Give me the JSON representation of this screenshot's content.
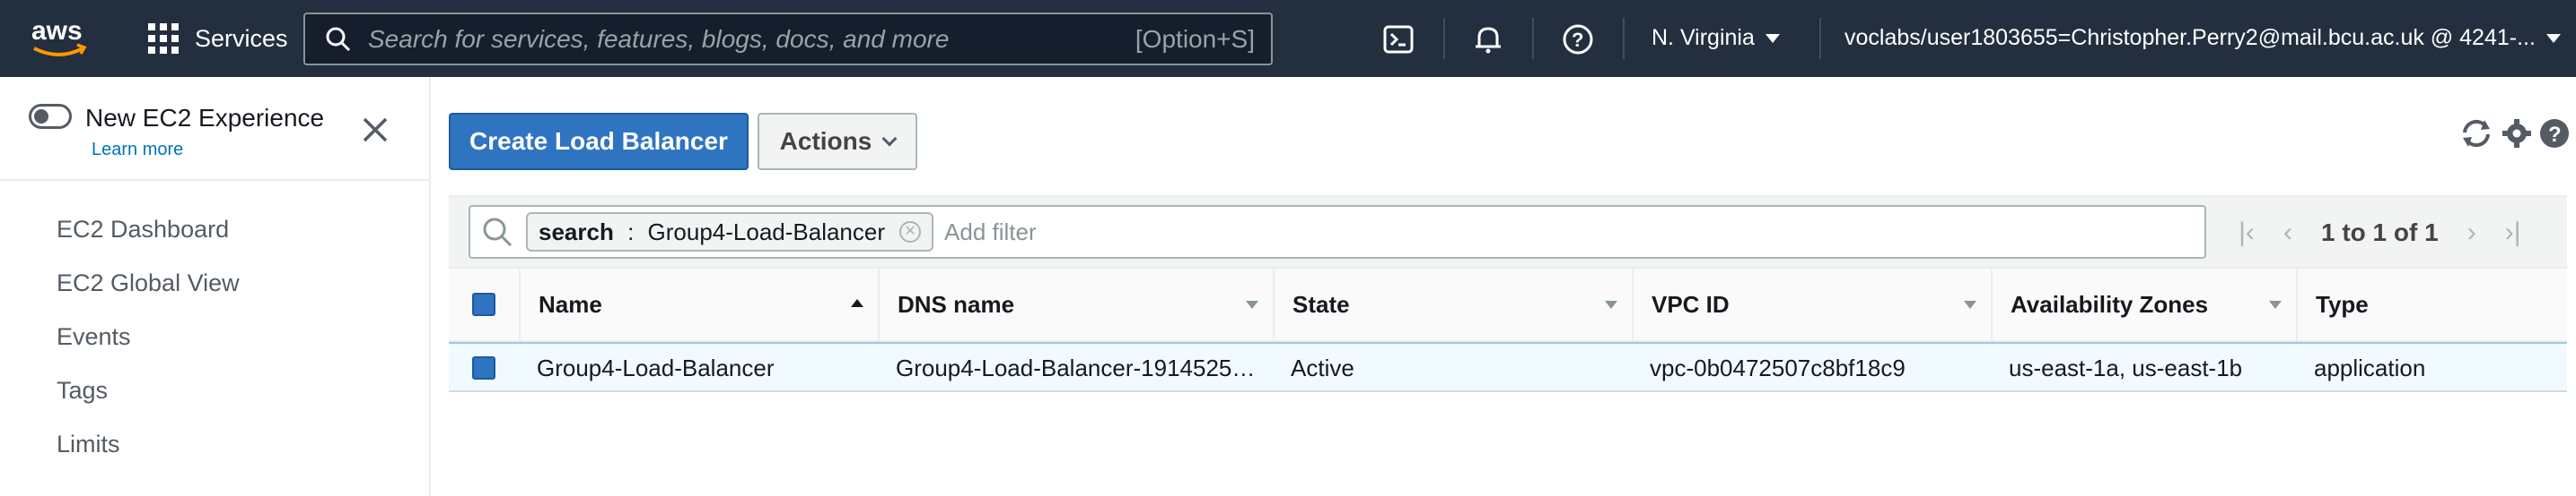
{
  "topnav": {
    "logo_text": "aws",
    "services_label": "Services",
    "search_placeholder": "Search for services, features, blogs, docs, and more",
    "search_shortcut": "[Option+S]",
    "region": "N. Virginia",
    "account": "voclabs/user1803655=Christopher.Perry2@mail.bcu.ac.uk @ 4241-..."
  },
  "sidebar": {
    "toggle_label": "New EC2 Experience",
    "learn_more": "Learn more",
    "items": [
      {
        "label": "EC2 Dashboard"
      },
      {
        "label": "EC2 Global View"
      },
      {
        "label": "Events"
      },
      {
        "label": "Tags"
      },
      {
        "label": "Limits"
      }
    ]
  },
  "toolbar": {
    "create_label": "Create Load Balancer",
    "actions_label": "Actions"
  },
  "filter": {
    "token_key": "search",
    "token_sep": " : ",
    "token_value": "Group4-Load-Balancer",
    "add_filter_placeholder": "Add filter",
    "pagination_text": "1 to 1 of 1"
  },
  "table": {
    "columns": [
      "Name",
      "DNS name",
      "State",
      "VPC ID",
      "Availability Zones",
      "Type"
    ],
    "rows": [
      {
        "name": "Group4-Load-Balancer",
        "dns": "Group4-Load-Balancer-1914525…",
        "state": "Active",
        "vpc": "vpc-0b0472507c8bf18c9",
        "azs": "us-east-1a, us-east-1b",
        "type": "application"
      }
    ]
  },
  "colors": {
    "nav_bg": "#232f3e",
    "primary": "#2f74c0",
    "selected_row": "#f1faff",
    "aws_orange": "#ff9900"
  }
}
